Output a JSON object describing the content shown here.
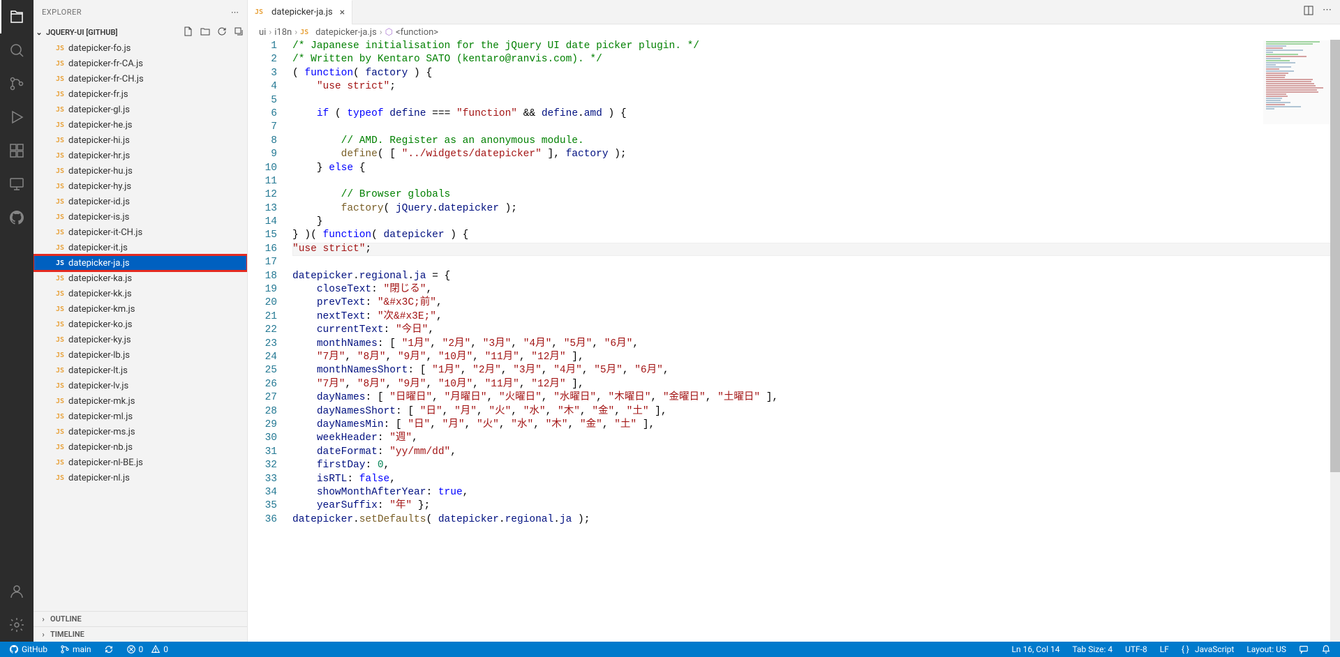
{
  "sidebar": {
    "title": "EXPLORER",
    "folder": "JQUERY-UI [GITHUB]",
    "files": [
      "datepicker-fo.js",
      "datepicker-fr-CA.js",
      "datepicker-fr-CH.js",
      "datepicker-fr.js",
      "datepicker-gl.js",
      "datepicker-he.js",
      "datepicker-hi.js",
      "datepicker-hr.js",
      "datepicker-hu.js",
      "datepicker-hy.js",
      "datepicker-id.js",
      "datepicker-is.js",
      "datepicker-it-CH.js",
      "datepicker-it.js",
      "datepicker-ja.js",
      "datepicker-ka.js",
      "datepicker-kk.js",
      "datepicker-km.js",
      "datepicker-ko.js",
      "datepicker-ky.js",
      "datepicker-lb.js",
      "datepicker-lt.js",
      "datepicker-lv.js",
      "datepicker-mk.js",
      "datepicker-ml.js",
      "datepicker-ms.js",
      "datepicker-nb.js",
      "datepicker-nl-BE.js",
      "datepicker-nl.js"
    ],
    "selected": "datepicker-ja.js",
    "outline": "OUTLINE",
    "timeline": "TIMELINE"
  },
  "tab": {
    "name": "datepicker-ja.js"
  },
  "breadcrumb": {
    "p0": "ui",
    "p1": "i18n",
    "p2": "datepicker-ja.js",
    "p3": "<function>"
  },
  "status": {
    "github": "GitHub",
    "branch": "main",
    "errors": "0",
    "warnings": "0",
    "lncol": "Ln 16, Col 14",
    "tabsize": "Tab Size: 4",
    "encoding": "UTF-8",
    "eol": "LF",
    "lang": "JavaScript",
    "layout": "Layout: US"
  },
  "lines": {
    "first": 1,
    "last": 36
  }
}
